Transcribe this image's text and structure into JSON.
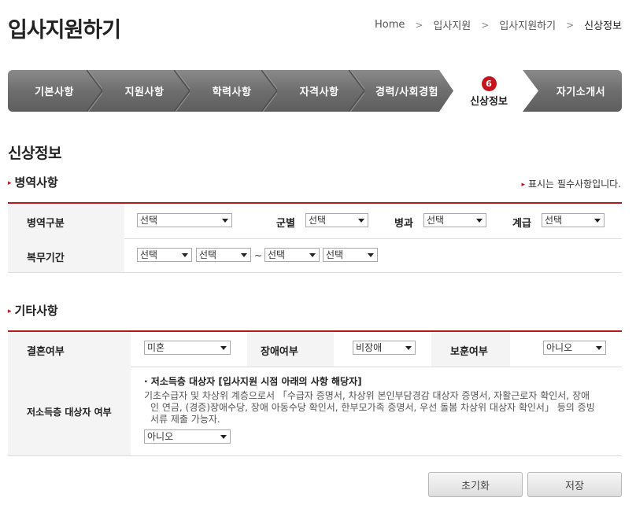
{
  "header": {
    "title": "입사지원하기",
    "breadcrumb": [
      "Home",
      "입사지원",
      "입사지원하기",
      "신상정보"
    ]
  },
  "steps": {
    "items": [
      "기본사항",
      "지원사항",
      "학력사항",
      "자격사항",
      "경력/사회경험",
      "신상정보",
      "자기소개서"
    ],
    "active_index": 5,
    "active_number": "6"
  },
  "section": {
    "title": "신상정보",
    "required_note": "표시는 필수사항입니다."
  },
  "military": {
    "title": "병역사항",
    "labels": {
      "category": "병역구분",
      "branch": "군별",
      "specialty": "병과",
      "rank": "계급",
      "service_period": "복무기간"
    },
    "values": {
      "category": "선택",
      "branch": "선택",
      "specialty": "선택",
      "rank": "선택",
      "start_year": "선택",
      "start_month": "선택",
      "end_year": "선택",
      "end_month": "선택",
      "tilde": "~"
    }
  },
  "other": {
    "title": "기타사항",
    "labels": {
      "married": "결혼여부",
      "disability": "장애여부",
      "veteran": "보훈여부",
      "low_income": "저소득층 대상자 여부"
    },
    "values": {
      "married": "미혼",
      "disability": "비장애",
      "veteran": "아니오",
      "low_income": "아니오"
    },
    "low_income_heading": "· 저소득층 대상자 [입사지원 시점 아래의 사항 해당자]",
    "low_income_desc": [
      "기초수급자 및 차상위 계층으로서 「수급자 증명서, 차상위 본인부담경감 대상자 증명서, 자활근로자 확인서, 장애",
      "인 연금, (경증)장애수당, 장애 아동수당 확인서, 한부모가족 증명서, 우선 돌봄 차상위 대상자 확인서」 등의 증빙",
      "서류 제출 가능자."
    ]
  },
  "buttons": {
    "reset": "초기화",
    "save": "저장"
  },
  "colors": {
    "accent": "#c4151c",
    "step_bar": "#707070"
  }
}
